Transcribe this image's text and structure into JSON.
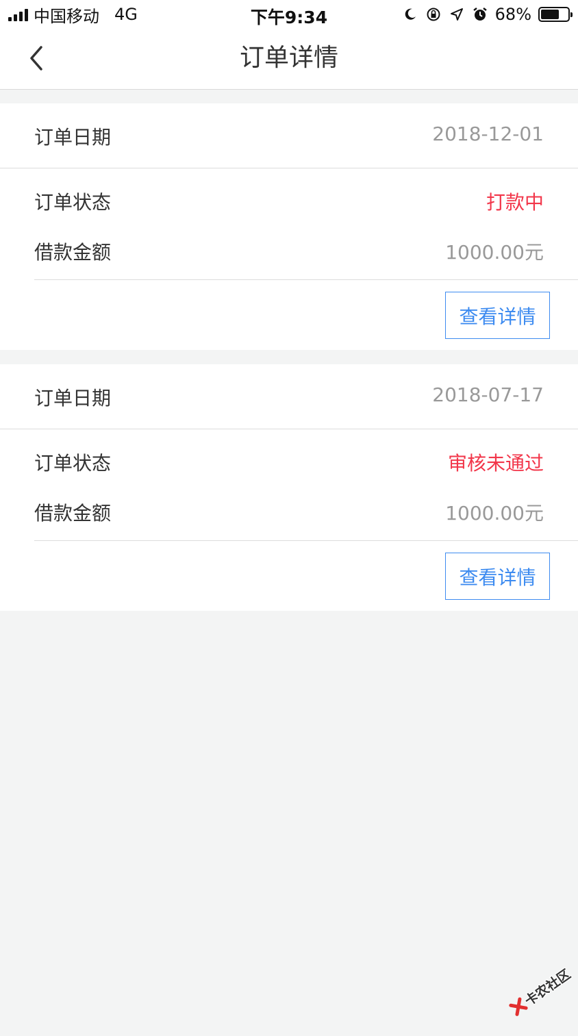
{
  "status_bar": {
    "carrier": "中国移动",
    "network": "4G",
    "time": "下午9:34",
    "battery_percent": "68%",
    "battery_level": 0.68,
    "icons": [
      "signal-bars-icon",
      "moon-icon",
      "orientation-lock-icon",
      "location-arrow-icon",
      "alarm-icon",
      "battery-icon"
    ]
  },
  "nav": {
    "title": "订单详情",
    "back_icon": "chevron-left-icon"
  },
  "orders": [
    {
      "date_label": "订单日期",
      "date": "2018-12-01",
      "status_label": "订单状态",
      "status": "打款中",
      "amount_label": "借款金额",
      "amount": "1000.00元",
      "button": "查看详情"
    },
    {
      "date_label": "订单日期",
      "date": "2018-07-17",
      "status_label": "订单状态",
      "status": "审核未通过",
      "amount_label": "借款金额",
      "amount": "1000.00元",
      "button": "查看详情"
    }
  ],
  "colors": {
    "status": "#f2364a",
    "button": "#3d8bf0",
    "background": "#f3f4f4"
  },
  "watermark": {
    "text": "卡农社区"
  }
}
